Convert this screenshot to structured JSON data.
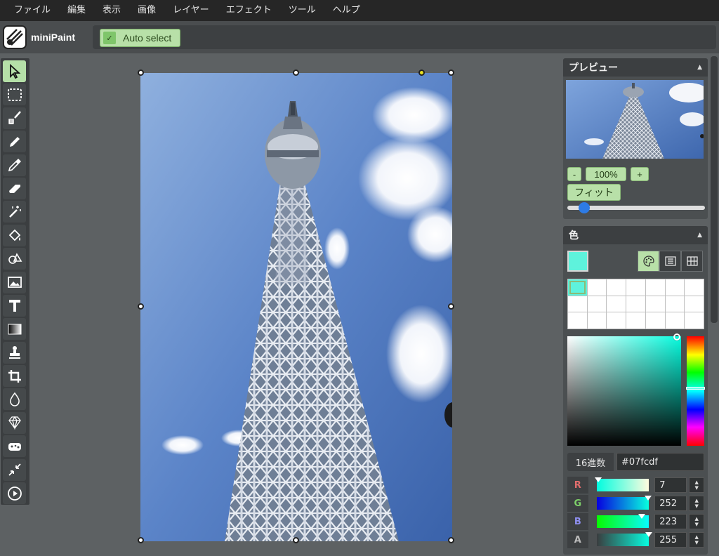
{
  "menu": {
    "items": [
      "ファイル",
      "編集",
      "表示",
      "画像",
      "レイヤー",
      "エフェクト",
      "ツール",
      "ヘルプ"
    ]
  },
  "brand": {
    "name": "miniPaint"
  },
  "attributes": {
    "auto_select_label": "Auto select",
    "auto_select_checked": true
  },
  "tools": [
    {
      "name": "select-tool",
      "icon": "cursor-arrow-icon",
      "active": true
    },
    {
      "name": "rectangle-select-tool",
      "icon": "dashed-rectangle-icon"
    },
    {
      "name": "brush-tool",
      "icon": "brush-icon"
    },
    {
      "name": "pencil-tool",
      "icon": "pencil-icon"
    },
    {
      "name": "color-picker-tool",
      "icon": "eyedropper-icon"
    },
    {
      "name": "erase-tool",
      "icon": "eraser-icon"
    },
    {
      "name": "magic-wand-tool",
      "icon": "magic-wand-icon"
    },
    {
      "name": "fill-tool",
      "icon": "paint-bucket-icon"
    },
    {
      "name": "shape-tool",
      "icon": "shapes-icon"
    },
    {
      "name": "media-tool",
      "icon": "image-icon"
    },
    {
      "name": "text-tool",
      "icon": "text-t-icon"
    },
    {
      "name": "gradient-tool",
      "icon": "gradient-icon"
    },
    {
      "name": "clone-tool",
      "icon": "stamp-icon"
    },
    {
      "name": "crop-tool",
      "icon": "crop-icon"
    },
    {
      "name": "blur-tool",
      "icon": "droplet-icon"
    },
    {
      "name": "sharpen-tool",
      "icon": "diamond-icon"
    },
    {
      "name": "bulge-pinch-tool",
      "icon": "sponge-icon"
    },
    {
      "name": "reduce-tool",
      "icon": "shrink-arrows-icon"
    },
    {
      "name": "animation-tool",
      "icon": "play-circle-icon"
    }
  ],
  "preview": {
    "title": "プレビュー",
    "zoom_minus": "-",
    "zoom_value": "100%",
    "zoom_plus": "+",
    "fit_label": "フィット",
    "zoom_slider_fraction": 0.08
  },
  "color": {
    "title": "色",
    "current": "#5ef2dc",
    "hex_label": "16進数",
    "hex_value": "#07fcdf",
    "channels": [
      {
        "label": "R",
        "value": "7",
        "color": "#e06d6d",
        "fraction": 0.03
      },
      {
        "label": "G",
        "value": "252",
        "color": "#7fd26a",
        "fraction": 0.99
      },
      {
        "label": "B",
        "value": "223",
        "color": "#8f8ff0",
        "fraction": 0.87
      },
      {
        "label": "A",
        "value": "255",
        "color": "#bbbbbb",
        "fraction": 1.0
      }
    ]
  }
}
